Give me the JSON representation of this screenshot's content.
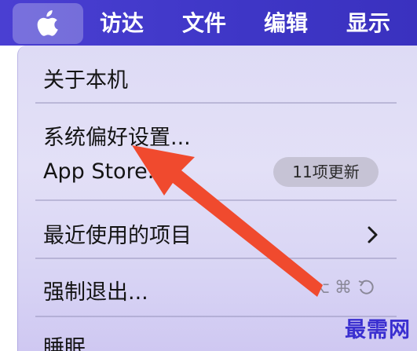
{
  "menubar": {
    "apple_icon": "apple-logo-icon",
    "items": [
      "访达",
      "文件",
      "编辑",
      "显示"
    ]
  },
  "apple_menu": {
    "items": {
      "about": "关于本机",
      "prefs": "系统偏好设置...",
      "appstore": "App Store...",
      "appstore_badge": "11项更新",
      "recent": "最近使用的项目",
      "force_quit": "强制退出...",
      "sleep": "睡眠"
    },
    "shortcut_force_quit": "⌘"
  },
  "annotation": {
    "arrow_color": "#f04a2e"
  },
  "watermark": "最需网",
  "colors": {
    "menubar": "#3e36c6",
    "menu_bg": "#e0ddf6",
    "watermark": "#3a2fd0"
  }
}
